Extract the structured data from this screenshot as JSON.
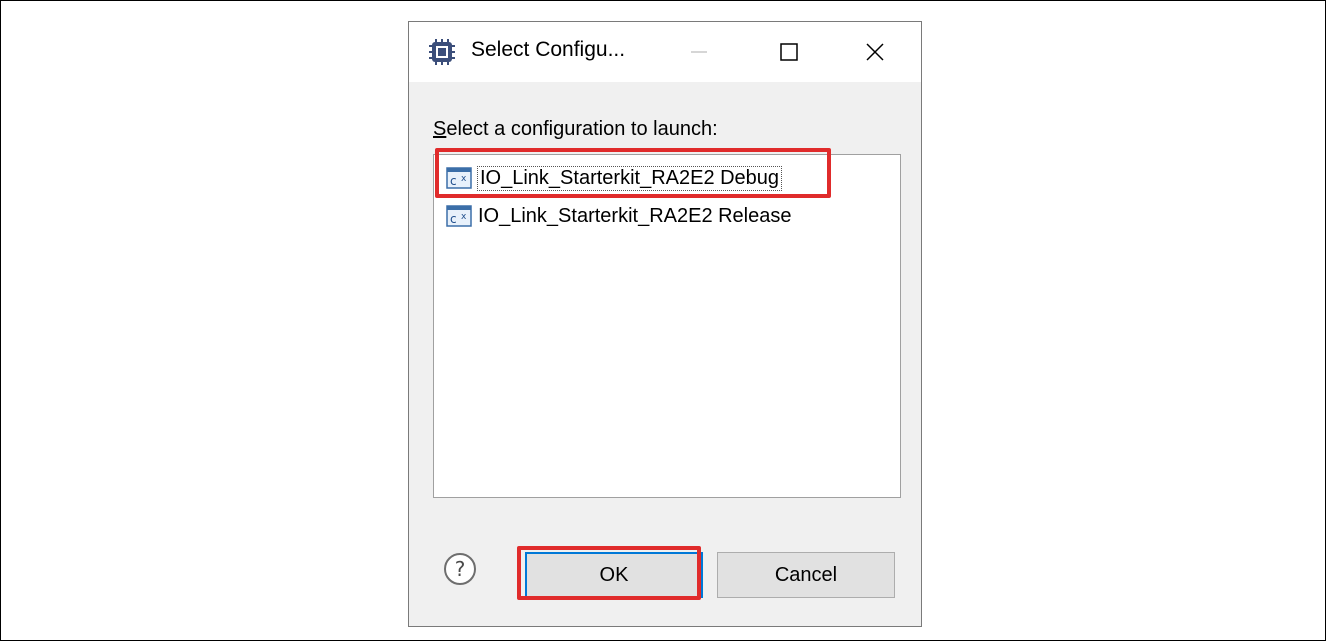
{
  "dialog": {
    "title": "Select Configu...",
    "prompt_accel": "S",
    "prompt_rest": "elect a configuration to launch:",
    "configurations": [
      {
        "label": "IO_Link_Starterkit_RA2E2 Debug",
        "icon": "c-application-icon",
        "selected": true
      },
      {
        "label": "IO_Link_Starterkit_RA2E2 Release",
        "icon": "c-application-icon",
        "selected": false
      }
    ],
    "buttons": {
      "ok": "OK",
      "cancel": "Cancel"
    }
  },
  "colors": {
    "highlight_box": "#e02b2b",
    "dialog_bg": "#f0f0f0",
    "focus_border": "#0078d7"
  }
}
